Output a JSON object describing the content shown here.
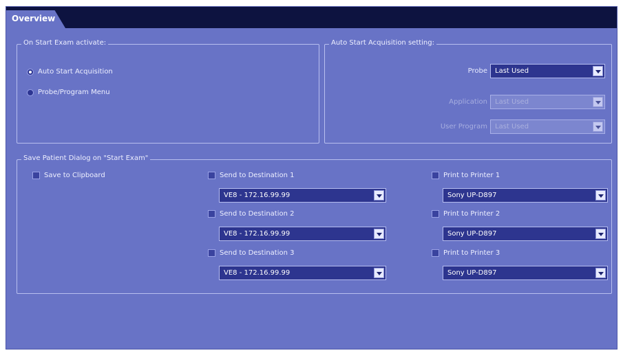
{
  "tabs": [
    {
      "label": "Overview"
    }
  ],
  "on_start": {
    "title": "On Start Exam activate:",
    "options": [
      {
        "label": "Auto Start Acquisition",
        "checked": true
      },
      {
        "label": "Probe/Program Menu",
        "checked": false
      }
    ]
  },
  "auto_start": {
    "title": "Auto Start Acquisition setting:",
    "fields": [
      {
        "label": "Probe",
        "value": "Last Used",
        "enabled": true
      },
      {
        "label": "Application",
        "value": "Last Used",
        "enabled": false
      },
      {
        "label": "User Program",
        "value": "Last Used",
        "enabled": false
      }
    ]
  },
  "save_dialog": {
    "title": "Save Patient Dialog on \"Start Exam\"",
    "clipboard_label": "Save to Clipboard",
    "destinations": [
      {
        "label": "Send to Destination 1",
        "value": "VE8 - 172.16.99.99"
      },
      {
        "label": "Send to Destination 2",
        "value": "VE8 - 172.16.99.99"
      },
      {
        "label": "Send to Destination 3",
        "value": "VE8 - 172.16.99.99"
      }
    ],
    "printers": [
      {
        "label": "Print to Printer 1",
        "value": "Sony UP-D897"
      },
      {
        "label": "Print to Printer 2",
        "value": "Sony UP-D897"
      },
      {
        "label": "Print to Printer 3",
        "value": "Sony UP-D897"
      }
    ]
  },
  "colors": {
    "panel": "#6873c6",
    "tabbar": "#0d1340",
    "select": "#2d358f"
  }
}
